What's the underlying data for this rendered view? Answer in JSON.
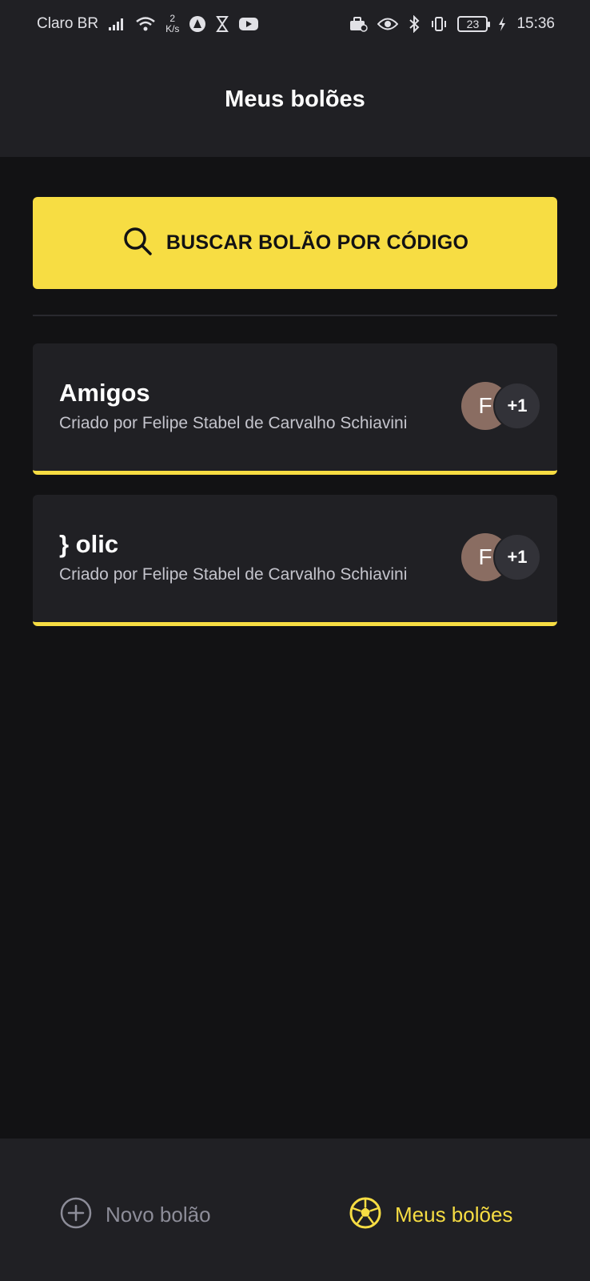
{
  "status_bar": {
    "carrier": "Claro BR",
    "speed_value": "2",
    "speed_unit": "K/s",
    "battery": "23",
    "time": "15:36"
  },
  "header": {
    "title": "Meus bolões"
  },
  "search_button": {
    "label": "BUSCAR BOLÃO POR CÓDIGO",
    "icon": "search-icon"
  },
  "pools": [
    {
      "title": "Amigos",
      "creator": "Criado por Felipe Stabel de Carvalho Schiavini",
      "avatar_initial": "F",
      "extra_count": "+1"
    },
    {
      "title": "} olic",
      "creator": "Criado por Felipe Stabel de Carvalho Schiavini",
      "avatar_initial": "F",
      "extra_count": "+1"
    }
  ],
  "bottom_nav": {
    "new_pool": {
      "label": "Novo bolão",
      "icon": "plus-circle-icon"
    },
    "my_pools": {
      "label": "Meus bolões",
      "icon": "soccer-ball-icon"
    }
  },
  "colors": {
    "accent": "#f7dd43",
    "background": "#121214",
    "surface": "#202024"
  }
}
